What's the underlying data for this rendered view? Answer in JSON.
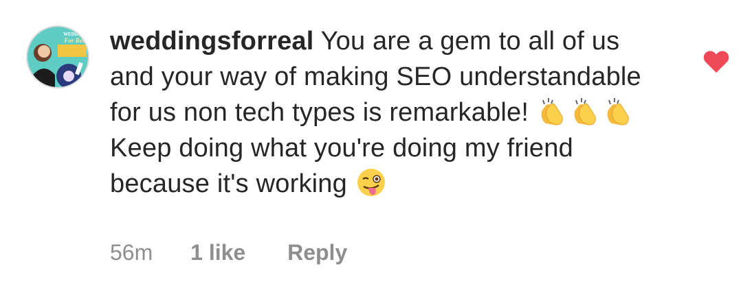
{
  "comment": {
    "avatar": {
      "brand_lines": [
        "WEDDINGS",
        "For Real"
      ]
    },
    "username": "weddingsforreal",
    "text_parts": [
      " You are a gem to all of us and your way of making SEO understandable for us non tech types is remarkable! ",
      "Keep doing what you're doing my friend because it's working "
    ],
    "emojis": {
      "clap": "clapping-hands",
      "wink": "winking-face-with-tongue"
    },
    "meta": {
      "time": "56m",
      "likes": "1 like",
      "reply": "Reply"
    },
    "liked": true,
    "colors": {
      "heart": "#ed4956",
      "meta_text": "#8e8e8e",
      "avatar_bg": "#5fcdc4"
    }
  }
}
